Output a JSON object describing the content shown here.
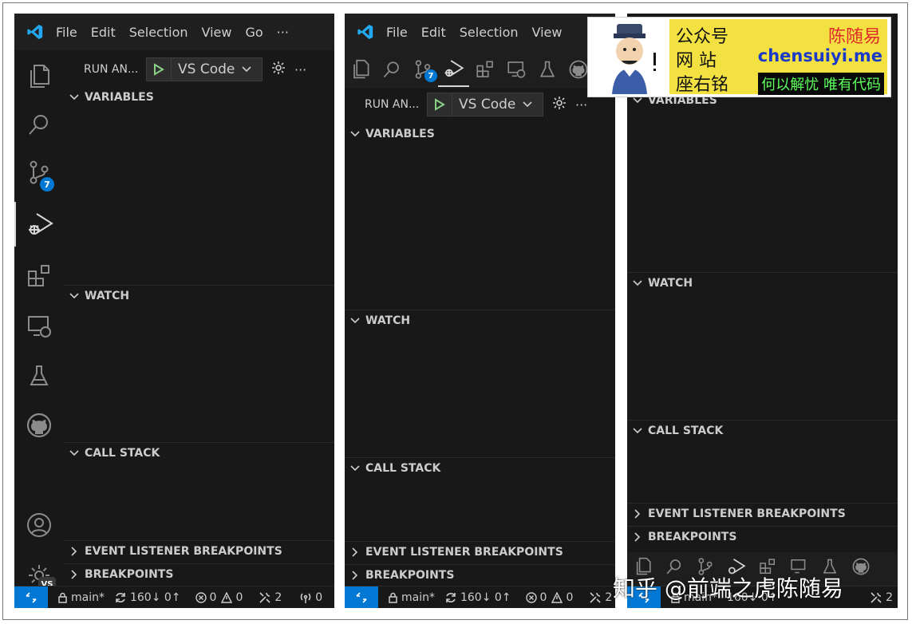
{
  "menu": {
    "file": "File",
    "edit": "Edit",
    "selection": "Selection",
    "view": "View",
    "go": "Go",
    "more": "···"
  },
  "run": {
    "label": "RUN AN...",
    "config": "VS Code"
  },
  "sections": {
    "variables": "VARIABLES",
    "watch": "WATCH",
    "call_stack": "CALL STACK",
    "event_listener": "EVENT LISTENER BREAKPOINTS",
    "breakpoints": "BREAKPOINTS"
  },
  "badges": {
    "scm": "7",
    "accounts": "VS"
  },
  "status": {
    "branch": "main*",
    "sync": "160↓ 0↑",
    "errors": "0",
    "warnings": "0",
    "tools": "2",
    "ports": "0",
    "tools_right": "2"
  },
  "banner": {
    "l1": "公众号",
    "l2": "网    站",
    "l3": "座右铭",
    "name": "陈随易",
    "site": "chensuiyi.me",
    "motto": "何以解忧  唯有代码"
  },
  "watermark": "知乎 @前端之虎陈随易",
  "colors": {
    "accent": "#0078d4",
    "editor_bg": "#1e1e1e",
    "side_bg": "#181818",
    "logo": "#23a9f2",
    "run_green": "#89d185",
    "banner_yellow": "#f2e141",
    "name_red": "#e0292b",
    "site_blue": "#1a39c9",
    "motto_green": "#5cff5c"
  }
}
